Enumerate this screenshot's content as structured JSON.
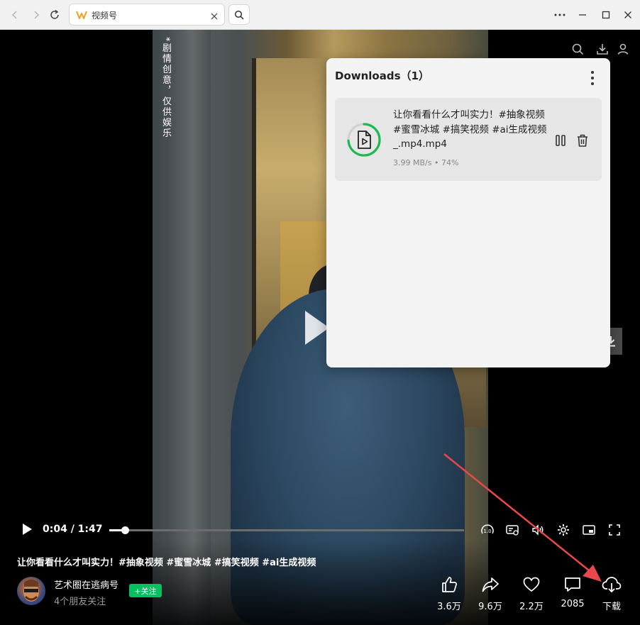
{
  "browser": {
    "tab_title": "视频号",
    "window_controls": [
      "more-icon",
      "minimize-icon",
      "maximize-icon",
      "close-icon"
    ]
  },
  "video": {
    "vertical_caption": "*剧情创意，仅供娱乐",
    "current_time": "0:04",
    "duration": "1:47",
    "time_display": "0:04 / 1:47",
    "progress_fraction": 0.044,
    "speed_label": "1.0"
  },
  "post": {
    "title": "让你看看什么才叫实力！#抽象视频 #蜜雪冰城 #搞笑视频 #ai生成视频",
    "author": "艺术圈在逃病号",
    "friends_following": "4个朋友关注",
    "follow_label": "+关注"
  },
  "actions": [
    {
      "name": "like",
      "icon": "thumbs-up-icon",
      "label": "3.6万"
    },
    {
      "name": "share",
      "icon": "share-icon",
      "label": "9.6万"
    },
    {
      "name": "favorite",
      "icon": "heart-icon",
      "label": "2.2万"
    },
    {
      "name": "comment",
      "icon": "comment-icon",
      "label": "2085"
    },
    {
      "name": "download",
      "icon": "cloud-download-icon",
      "label": "下载"
    }
  ],
  "downloads": {
    "title": "Downloads（1）",
    "items": [
      {
        "file_name": "让你看看什么才叫实力！#抽象视频 #蜜雪冰城 #搞笑视频 #ai生成视频_.mp4.mp4",
        "meta": "3.99 MB/s • 74%",
        "progress": 0.74
      }
    ]
  },
  "colors": {
    "accent_green": "#07c160",
    "progress_ring": "#1db954",
    "annotation_arrow": "#e8474b"
  }
}
